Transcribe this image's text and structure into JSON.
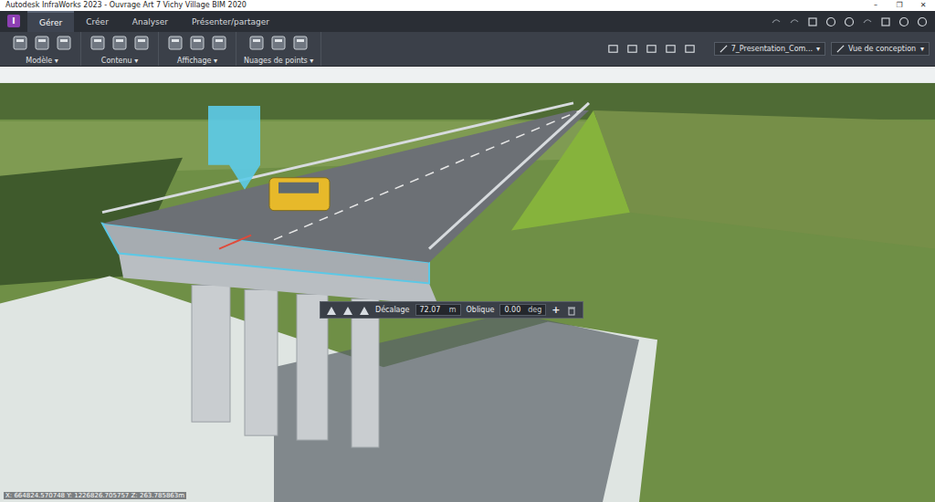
{
  "window": {
    "title": "Autodesk InfraWorks 2023 - Ouvrage Art 7 Vichy Village BIM 2020",
    "controls": [
      "–",
      "❐",
      "✕"
    ]
  },
  "app_badge": "I",
  "tabs": [
    {
      "label": "Gérer",
      "selected": true
    },
    {
      "label": "Créer",
      "selected": false
    },
    {
      "label": "Analyser",
      "selected": false
    },
    {
      "label": "Présenter/partager",
      "selected": false
    }
  ],
  "ribbon": {
    "dropdown_arrow": "▾",
    "groups": [
      {
        "label": "Modèle"
      },
      {
        "label": "Contenu"
      },
      {
        "label": "Affichage"
      },
      {
        "label": "Nuages de points"
      }
    ]
  },
  "selectors": [
    {
      "label": "7_Presentation_Com..."
    },
    {
      "label": "Vue de conception"
    }
  ],
  "edit_toolbar": {
    "offset_label": "Décalage",
    "offset_value": "72.07",
    "offset_unit": "m",
    "skew_label": "Oblique",
    "skew_value": "0.00",
    "skew_unit": "deg",
    "add": "+"
  },
  "status_bar": {
    "coordinates": "X: 664824.570748 Y: 1226826.705757 Z: 263.785863m"
  }
}
